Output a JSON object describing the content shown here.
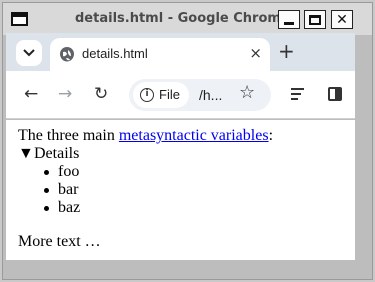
{
  "window": {
    "title": "details.html - Google Chrome"
  },
  "tabs": [
    {
      "label": "details.html",
      "close": "×"
    }
  ],
  "toolbar": {
    "newtab": "+",
    "back": "←",
    "forward": "→",
    "reload": "↻",
    "chip_info": "i",
    "chip_label": "File",
    "url": "/h...",
    "star": "☆"
  },
  "page": {
    "intro_prefix": "The three main ",
    "intro_link": "metasyntactic variables",
    "intro_suffix": ":",
    "summary_marker": "▼",
    "summary": "Details",
    "items": [
      "foo",
      "bar",
      "baz"
    ],
    "more_text": "More text …"
  }
}
